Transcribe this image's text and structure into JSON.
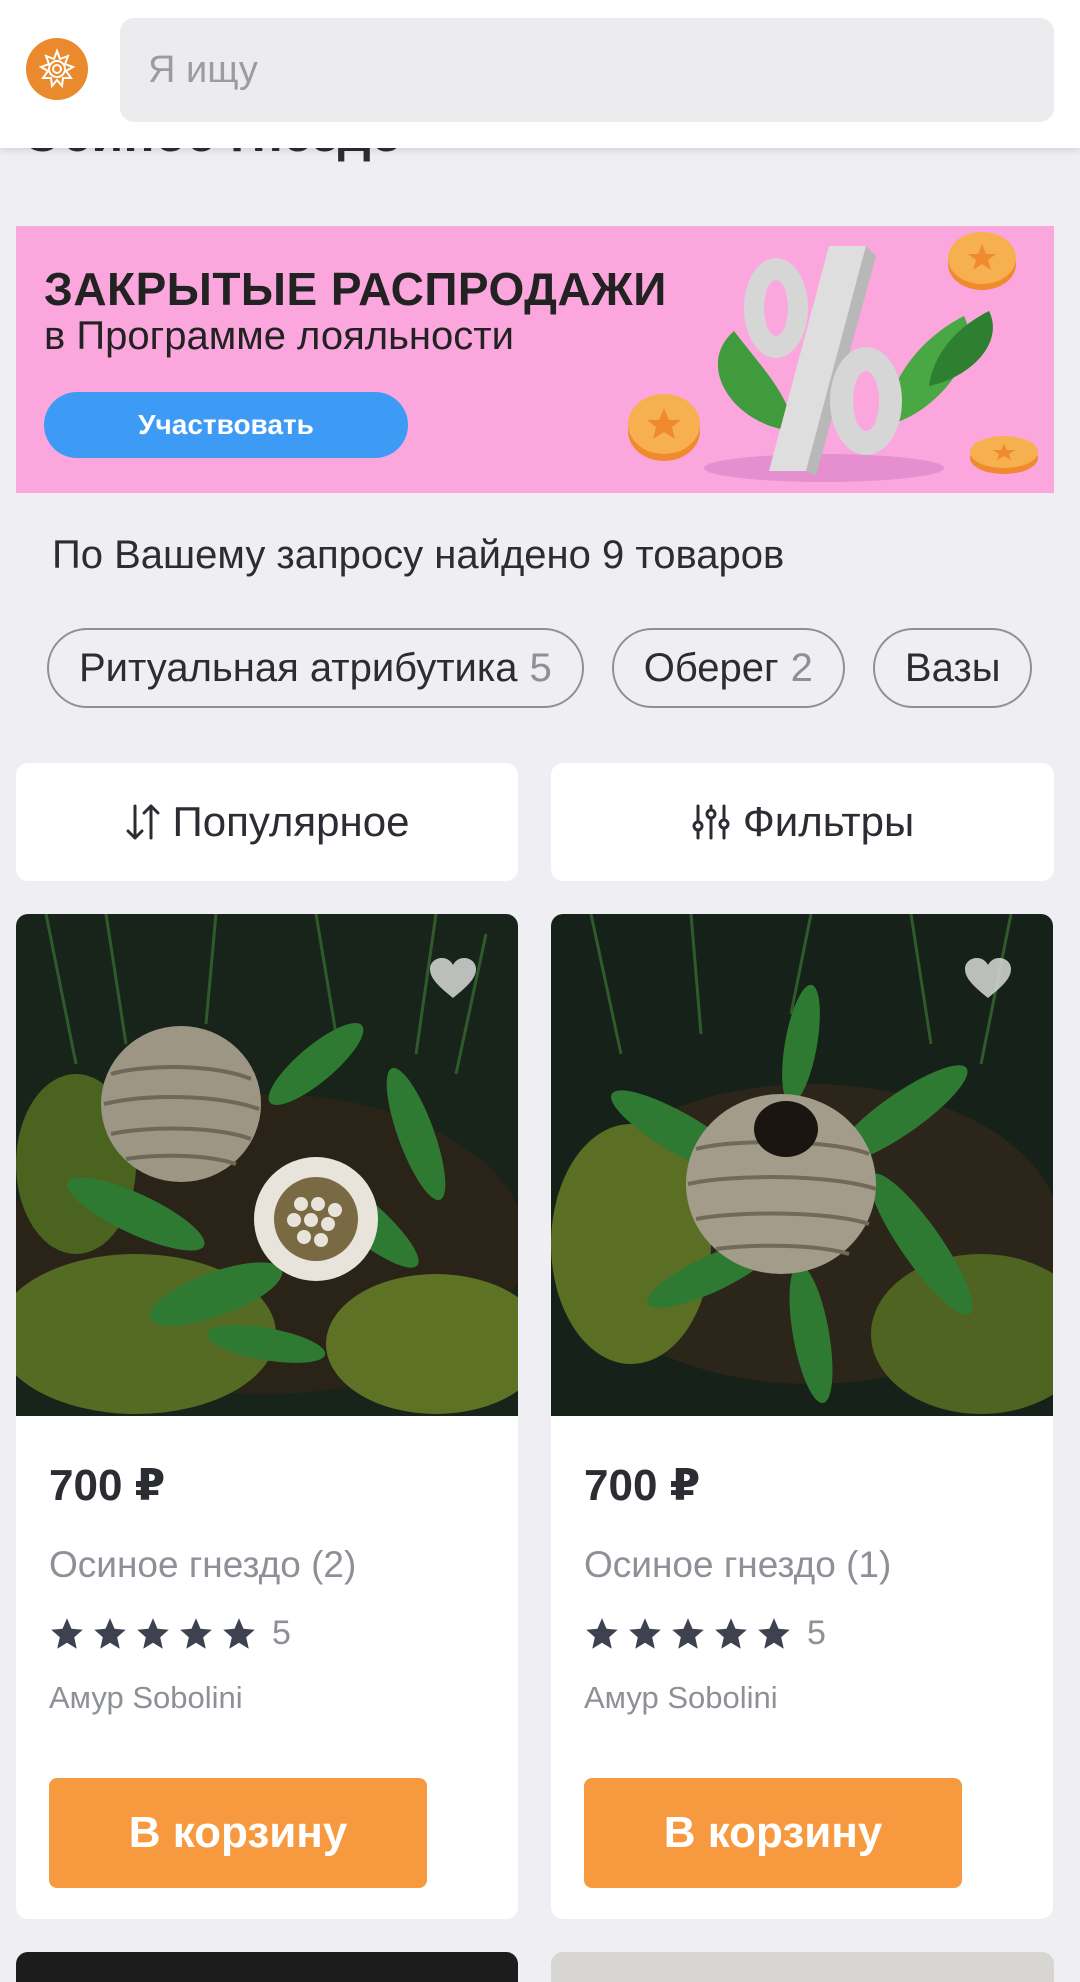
{
  "header": {
    "logo_icon": "sun-emblem-icon",
    "search_placeholder": "Я ищу"
  },
  "page_title": "Осиное гнездо",
  "banner": {
    "title": "ЗАКРЫТЫЕ РАСПРОДАЖИ",
    "subtitle": "в Программе лояльности",
    "button_label": "Участвовать"
  },
  "results": {
    "summary": "По Вашему запросу найдено 9 товаров",
    "chips": [
      {
        "label": "Ритуальная атрибутика",
        "count": "5"
      },
      {
        "label": "Оберег",
        "count": "2"
      },
      {
        "label": "Вазы",
        "count": ""
      }
    ]
  },
  "controls": {
    "sort_label": "Популярное",
    "sort_icon": "sort-arrows-icon",
    "filter_label": "Фильтры",
    "filter_icon": "sliders-icon"
  },
  "products": [
    {
      "price": "700 ₽",
      "name": "Осиное гнездо (2)",
      "rating_value": "5",
      "stars": 5,
      "seller": "Амур Sobolini",
      "cart_label": "В корзину"
    },
    {
      "price": "700 ₽",
      "name": "Осиное гнездо (1)",
      "rating_value": "5",
      "stars": 5,
      "seller": "Амур Sobolini",
      "cart_label": "В корзину"
    }
  ],
  "colors": {
    "accent_orange": "#f79a3f",
    "banner_pink": "#fba7de",
    "banner_button_blue": "#3d9bf5",
    "background": "#efeef2"
  }
}
